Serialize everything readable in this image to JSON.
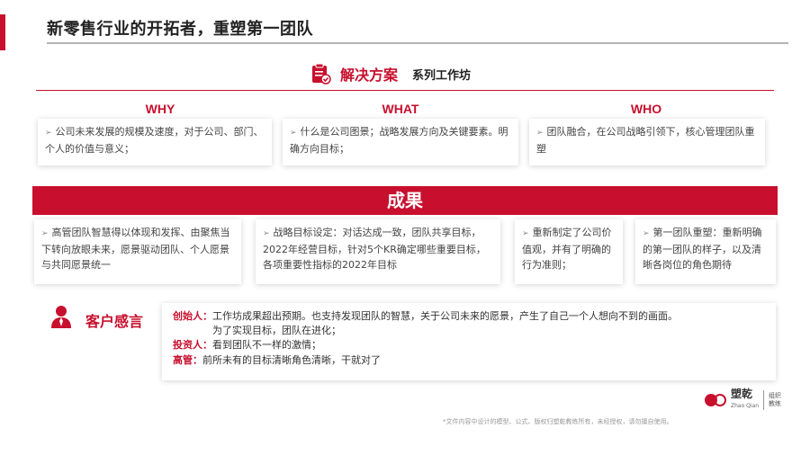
{
  "page": {
    "title": "新零售行业的开拓者，重塑第一团队",
    "accent": "#c8102e"
  },
  "solution": {
    "label": "解决方案",
    "subtitle": "系列工作坊",
    "icon": "clipboard-check-icon"
  },
  "columns": [
    {
      "heading": "WHY",
      "text": "公司未来发展的规模及速度，对于公司、部门、个人的价值与意义；"
    },
    {
      "heading": "WHAT",
      "text": "什么是公司图景；战略发展方向及关键要素。明确方向目标；"
    },
    {
      "heading": "WHO",
      "text": "团队融合，在公司战略引领下，核心管理团队重塑"
    }
  ],
  "results": {
    "title": "成果",
    "items": [
      "高管团队智慧得以体现和发挥、由聚焦当下转向放眼未来，愿景驱动团队、个人愿景与共同愿景统一",
      "战略目标设定：对话达成一致，团队共享目标，2022年经营目标，针对5个KR确定哪些重要目标，各项重要性指标的2022年目标",
      "重新制定了公司价值观，并有了明确的行为准则；",
      "第一团队重塑：重新明确的第一团队的样子，以及清晰各岗位的角色期待"
    ]
  },
  "feedback": {
    "label": "客户感言",
    "icon": "person-icon",
    "quotes": [
      {
        "role": "创始人：",
        "text": "工作坊成果超出预期。也支持发现团队的智慧，关于公司未来的愿景，产生了自己一个人想向不到的画面。"
      },
      {
        "role": "",
        "text": "为了实现目标，团队在进化；"
      },
      {
        "role": "投资人：",
        "text": "看到团队不一样的激情；"
      },
      {
        "role": "高管：",
        "text": "前所未有的目标清晰角色清晰，干就对了"
      }
    ]
  },
  "logo": {
    "name": "塑乾",
    "en": "Zhao Qian",
    "tag1": "组织",
    "tag2": "教练"
  },
  "footer": "*文件内容中设计的模型、公式、版权归塑乾教练所有，未经授权，请勿擅自使用。"
}
